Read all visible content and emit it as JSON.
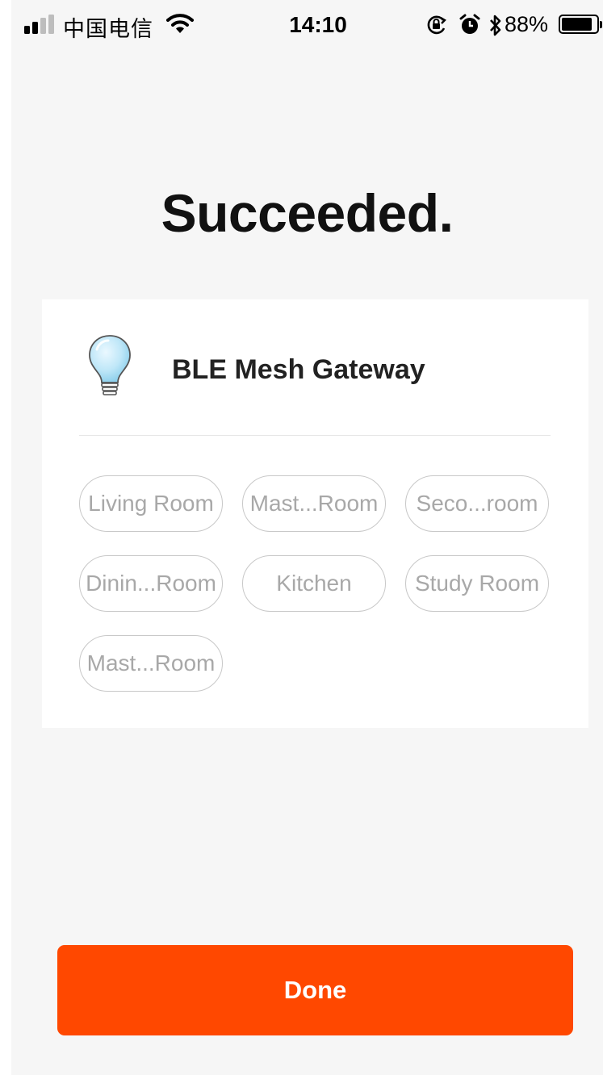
{
  "status_bar": {
    "carrier": "中国电信",
    "time": "14:10",
    "battery_percent": "88%",
    "battery_level": 0.88,
    "signal_bars": 2,
    "signal_total": 4,
    "icons": [
      "wifi-icon",
      "orientation-lock-icon",
      "alarm-icon",
      "bluetooth-icon",
      "battery-icon"
    ]
  },
  "page": {
    "title": "Succeeded."
  },
  "device": {
    "name": "BLE Mesh Gateway",
    "icon": "light-bulb-icon"
  },
  "rooms": [
    {
      "label": "Living Room",
      "selected": false
    },
    {
      "label": "Mast...Room",
      "selected": false
    },
    {
      "label": "Seco...room",
      "selected": false
    },
    {
      "label": "Dinin...Room",
      "selected": false
    },
    {
      "label": "Kitchen",
      "selected": false
    },
    {
      "label": "Study Room",
      "selected": false
    },
    {
      "label": "Mast...Room",
      "selected": false
    }
  ],
  "actions": {
    "done_label": "Done"
  },
  "colors": {
    "accent": "#ff4800",
    "background": "#f6f6f6",
    "card": "#ffffff",
    "chip_border": "#c8c8c8",
    "chip_text": "#a8a8a8"
  }
}
